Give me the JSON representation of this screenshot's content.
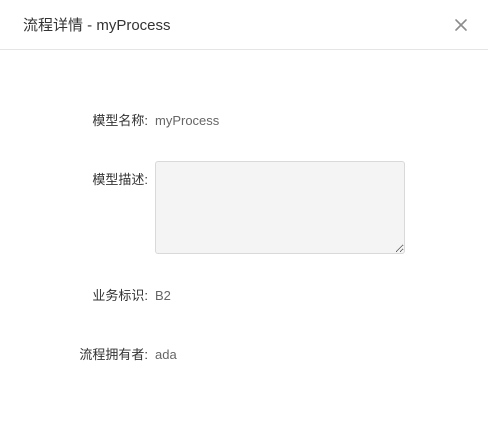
{
  "dialog": {
    "title": "流程详情 - myProcess",
    "close_icon": "close-icon"
  },
  "fields": {
    "model_name": {
      "label": "模型名称:",
      "value": "myProcess"
    },
    "model_description": {
      "label": "模型描述:",
      "value": "",
      "placeholder": ""
    },
    "business_key": {
      "label": "业务标识:",
      "value": "B2"
    },
    "process_owner": {
      "label": "流程拥有者:",
      "value": "ada"
    }
  },
  "colors": {
    "title_text": "#333333",
    "label_text": "#333333",
    "value_text": "#666666",
    "textarea_bg": "#f4f4f4",
    "border": "#d9d9d9",
    "divider": "#e5e5e5"
  }
}
